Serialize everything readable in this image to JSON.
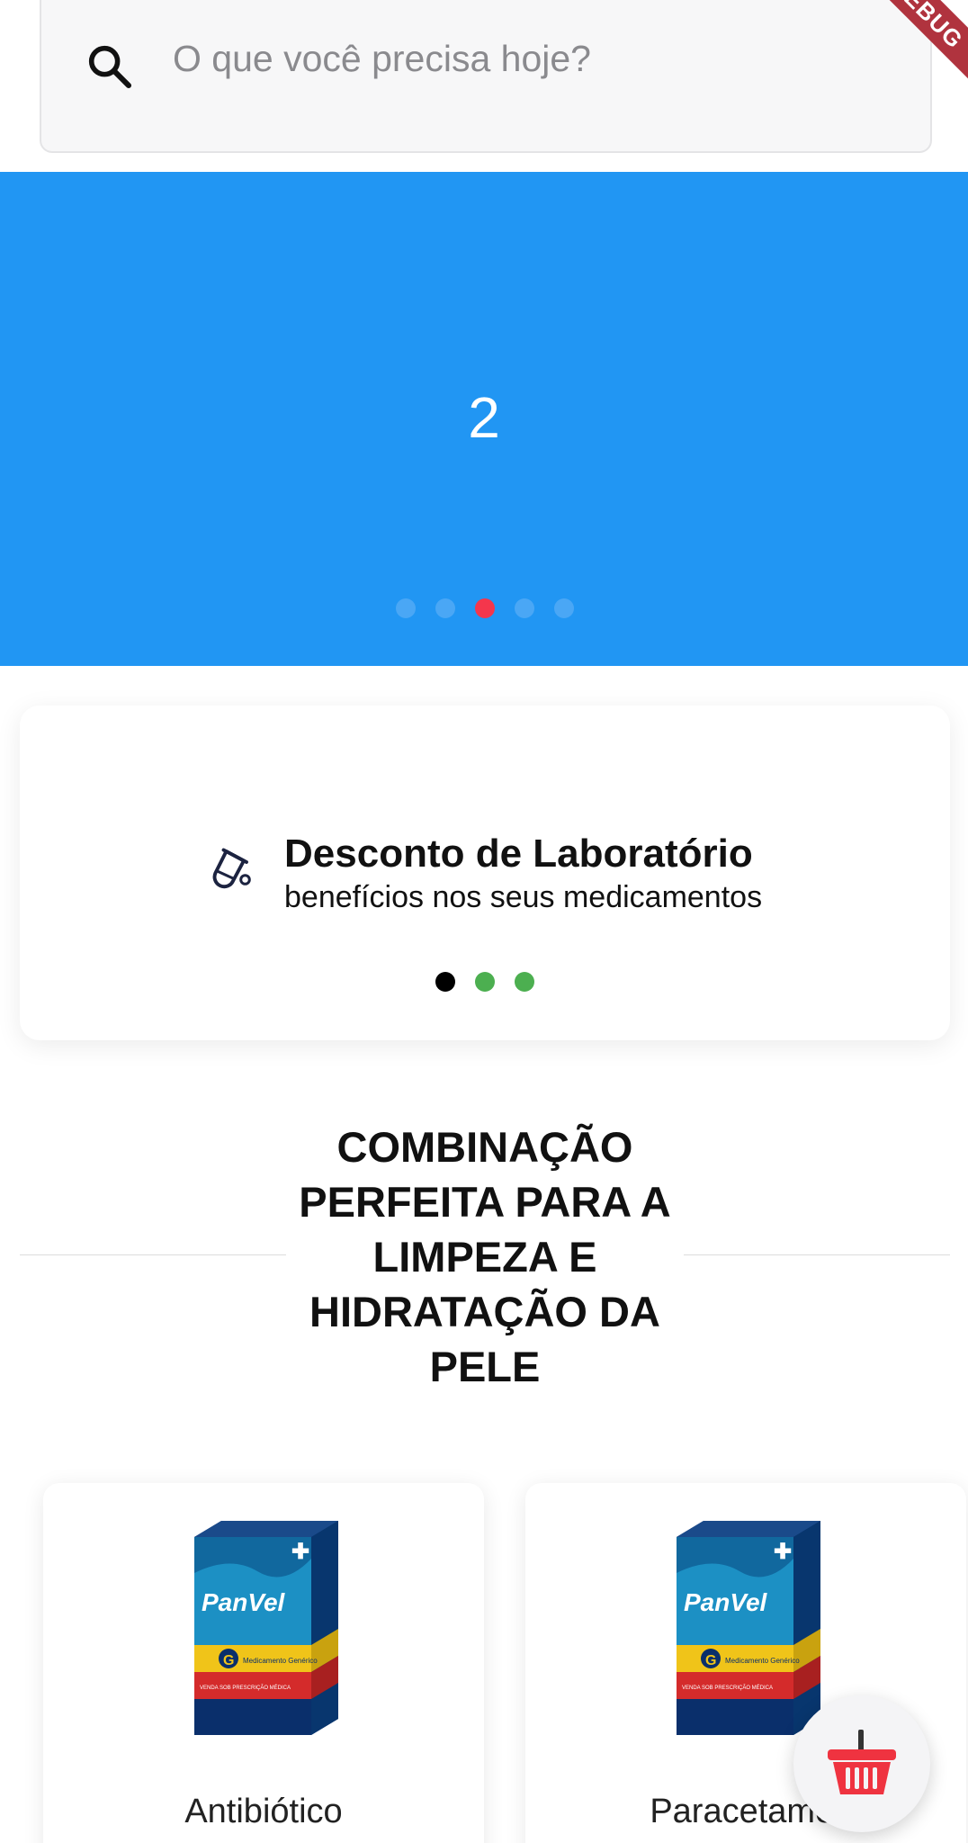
{
  "search": {
    "placeholder": "O que você precisa hoje?",
    "icon": "search-icon"
  },
  "debug_banner": {
    "label": "DEBUG"
  },
  "banner_carousel": {
    "current_label": "2",
    "dot_count": 5,
    "active_index": 2,
    "color": "#2196f3",
    "active_dot_color": "#f4364c"
  },
  "info_carousel": {
    "icon": "lab-flask-icon",
    "title": "Desconto de Laboratório",
    "subtitle": "benefícios nos seus medicamentos",
    "dot_count": 3,
    "active_index": 0,
    "active_dot_color": "#000000",
    "inactive_dot_color": "#4caf50"
  },
  "section": {
    "title": "COMBINAÇÃO PERFEITA PARA A LIMPEZA E HIDRATAÇÃO DA PELE"
  },
  "products": [
    {
      "name": "Antibiótico",
      "brand": "PanVel",
      "box_line_1": "G",
      "box_line_2": "Medicamento Genérico",
      "box_footer": "VENDA SOB PRESCRIÇÃO MÉDICA"
    },
    {
      "name": "Paracetamol",
      "brand": "PanVel",
      "box_line_1": "G",
      "box_line_2": "Medicamento Genérico",
      "box_footer": "VENDA SOB PRESCRIÇÃO MÉDICA"
    }
  ],
  "cart": {
    "icon": "shopping-basket-icon",
    "color": "#ef3340"
  }
}
